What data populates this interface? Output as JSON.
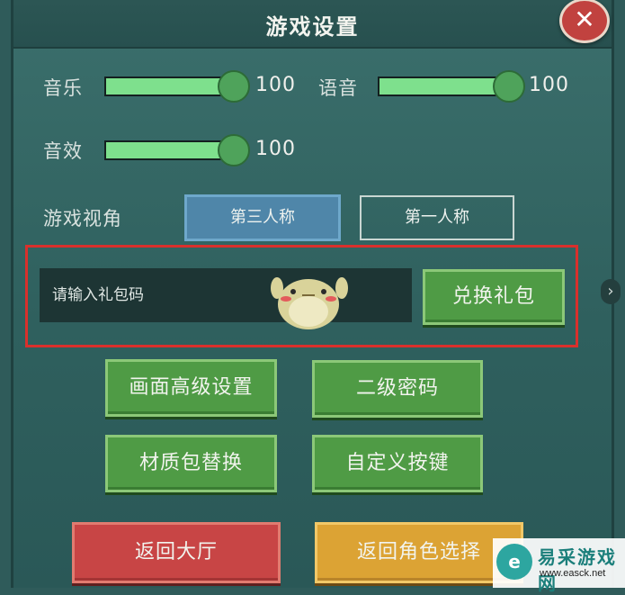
{
  "header": {
    "title": "游戏设置"
  },
  "audio": {
    "music": {
      "label": "音乐",
      "value": "100",
      "level_percent": 100
    },
    "voice": {
      "label": "语音",
      "value": "100",
      "level_percent": 100
    },
    "sfx": {
      "label": "音效",
      "value": "100",
      "level_percent": 100
    }
  },
  "view": {
    "label": "游戏视角",
    "tabs": [
      "第三人称",
      "第一人称"
    ],
    "selected": "第三人称"
  },
  "redeem": {
    "placeholder": "请输入礼包码",
    "button": "兑换礼包"
  },
  "options": [
    "画面高级设置",
    "二级密码",
    "材质包替换",
    "自定义按键"
  ],
  "bottom": {
    "return_lobby": "返回大厅",
    "return_role": "返回角色选择"
  },
  "watermark": {
    "text": "易采游戏网",
    "url": "www.easck.net"
  },
  "icons": {
    "close": "close-x-icon",
    "next": "chevron-right-icon"
  },
  "colors": {
    "accent_green": "#4f9b45",
    "slider_fill": "#7ee08d",
    "tab_active": "#4f86a9",
    "highlight_box": "#d9302c",
    "red_button": "#c84545",
    "orange_button": "#dca334"
  }
}
